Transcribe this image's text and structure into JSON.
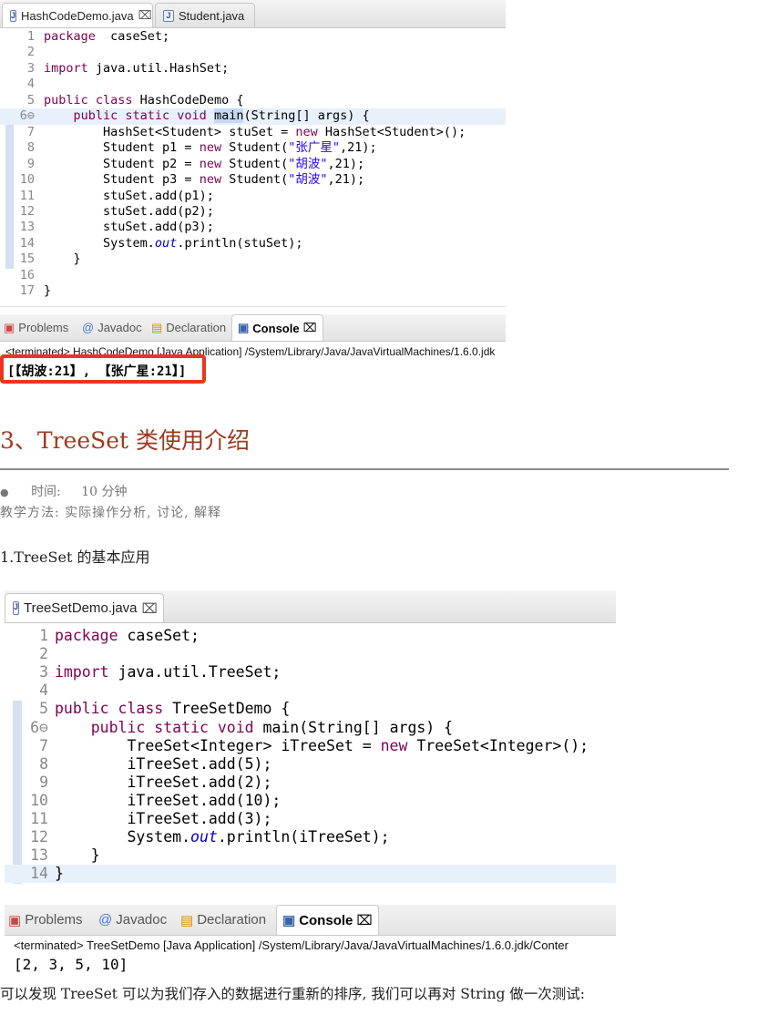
{
  "editor1": {
    "tabs": [
      {
        "label": "HashCodeDemo.java",
        "close": "⌧",
        "active": true
      },
      {
        "label": "Student.java",
        "active": false
      }
    ],
    "lines": [
      {
        "n": "1",
        "t": [
          [
            "kw",
            "package"
          ],
          [
            "",
            "  caseSet;"
          ]
        ]
      },
      {
        "n": "2",
        "t": []
      },
      {
        "n": "3",
        "t": [
          [
            "kw",
            "import"
          ],
          [
            "",
            " java.util.HashSet;"
          ]
        ]
      },
      {
        "n": "4",
        "t": []
      },
      {
        "n": "5",
        "t": [
          [
            "kw",
            "public class"
          ],
          [
            "",
            " HashCodeDemo {"
          ]
        ]
      },
      {
        "n": "6⊖",
        "hl": true,
        "t": [
          [
            "",
            "    "
          ],
          [
            "kw",
            "public static void"
          ],
          [
            "",
            " "
          ],
          [
            "sel",
            "main"
          ],
          [
            "",
            "(String[] args) {"
          ]
        ]
      },
      {
        "n": "7",
        "t": [
          [
            "",
            "        HashSet<Student> stuSet = "
          ],
          [
            "kw",
            "new"
          ],
          [
            "",
            " HashSet<Student>();"
          ]
        ]
      },
      {
        "n": "8",
        "t": [
          [
            "",
            "        Student p1 = "
          ],
          [
            "kw",
            "new"
          ],
          [
            "",
            " Student("
          ],
          [
            "str",
            "\"张广星\""
          ],
          [
            "",
            ",21);"
          ]
        ]
      },
      {
        "n": "9",
        "t": [
          [
            "",
            "        Student p2 = "
          ],
          [
            "kw",
            "new"
          ],
          [
            "",
            " Student("
          ],
          [
            "str",
            "\"胡波\""
          ],
          [
            "",
            ",21);"
          ]
        ]
      },
      {
        "n": "10",
        "t": [
          [
            "",
            "        Student p3 = "
          ],
          [
            "kw",
            "new"
          ],
          [
            "",
            " Student("
          ],
          [
            "str",
            "\"胡波\""
          ],
          [
            "",
            ",21);"
          ]
        ]
      },
      {
        "n": "11",
        "t": [
          [
            "",
            "        stuSet.add(p1);"
          ]
        ]
      },
      {
        "n": "12",
        "t": [
          [
            "",
            "        stuSet.add(p2);"
          ]
        ]
      },
      {
        "n": "13",
        "t": [
          [
            "",
            "        stuSet.add(p3);"
          ]
        ]
      },
      {
        "n": "14",
        "t": [
          [
            "",
            "        System."
          ],
          [
            "fld",
            "out"
          ],
          [
            "",
            ".println(stuSet);"
          ]
        ]
      },
      {
        "n": "15",
        "t": [
          [
            "",
            "    }"
          ]
        ]
      },
      {
        "n": "16",
        "t": []
      },
      {
        "n": "17",
        "t": [
          [
            "",
            "}"
          ]
        ]
      }
    ]
  },
  "console1": {
    "tabs": [
      "Problems",
      "Javadoc",
      "Declaration",
      "Console"
    ],
    "close": "⌧",
    "terminated": "<terminated> HashCodeDemo [Java Application] /System/Library/Java/JavaVirtualMachines/1.6.0.jdk",
    "output": "[【胡波:21】, 【张广星:21】]"
  },
  "doc": {
    "heading": "3、TreeSet 类使用介绍",
    "bullet": "●",
    "time_label": "时间:",
    "time_value": "10 分钟",
    "method": "教学方法: 实际操作分析, 讨论, 解释",
    "subheading": "1.TreeSet 的基本应用",
    "footer": "可以发现 TreeSet 可以为我们存入的数据进行重新的排序, 我们可以再对 String 做一次测试:"
  },
  "editor2": {
    "tabs": [
      {
        "label": "TreeSetDemo.java",
        "close": "⌧",
        "active": true
      }
    ],
    "lines": [
      {
        "n": "1",
        "t": [
          [
            "kw",
            "package"
          ],
          [
            "",
            " caseSet;"
          ]
        ]
      },
      {
        "n": "2",
        "t": []
      },
      {
        "n": "3",
        "t": [
          [
            "kw",
            "import"
          ],
          [
            "",
            " java.util.TreeSet;"
          ]
        ]
      },
      {
        "n": "4",
        "t": []
      },
      {
        "n": "5",
        "t": [
          [
            "kw",
            "public class"
          ],
          [
            "",
            " TreeSetDemo {"
          ]
        ]
      },
      {
        "n": "6⊖",
        "t": [
          [
            "",
            "    "
          ],
          [
            "kw",
            "public static void"
          ],
          [
            "",
            " main(String[] args) {"
          ]
        ]
      },
      {
        "n": "7",
        "t": [
          [
            "",
            "        TreeSet<Integer> iTreeSet = "
          ],
          [
            "kw",
            "new"
          ],
          [
            "",
            " TreeSet<Integer>();"
          ]
        ]
      },
      {
        "n": "8",
        "t": [
          [
            "",
            "        iTreeSet.add(5);"
          ]
        ]
      },
      {
        "n": "9",
        "t": [
          [
            "",
            "        iTreeSet.add(2);"
          ]
        ]
      },
      {
        "n": "10",
        "t": [
          [
            "",
            "        iTreeSet.add(10);"
          ]
        ]
      },
      {
        "n": "11",
        "t": [
          [
            "",
            "        iTreeSet.add(3);"
          ]
        ]
      },
      {
        "n": "12",
        "t": [
          [
            "",
            "        System."
          ],
          [
            "fld",
            "out"
          ],
          [
            "",
            ".println(iTreeSet);"
          ]
        ]
      },
      {
        "n": "13",
        "t": [
          [
            "",
            "    }"
          ]
        ]
      },
      {
        "n": "14",
        "hl": true,
        "t": [
          [
            "",
            "}"
          ]
        ]
      }
    ]
  },
  "console2": {
    "tabs": [
      "Problems",
      "Javadoc",
      "Declaration",
      "Console"
    ],
    "close": "⌧",
    "terminated": "<terminated> TreeSetDemo [Java Application] /System/Library/Java/JavaVirtualMachines/1.6.0.jdk/Conter",
    "output": "[2, 3, 5, 10]"
  },
  "colors": {
    "heading": "#a0381f",
    "keyword": "#7f0055",
    "string": "#2a00ff",
    "field": "#0000c0",
    "highlight_box": "#ee3322"
  }
}
